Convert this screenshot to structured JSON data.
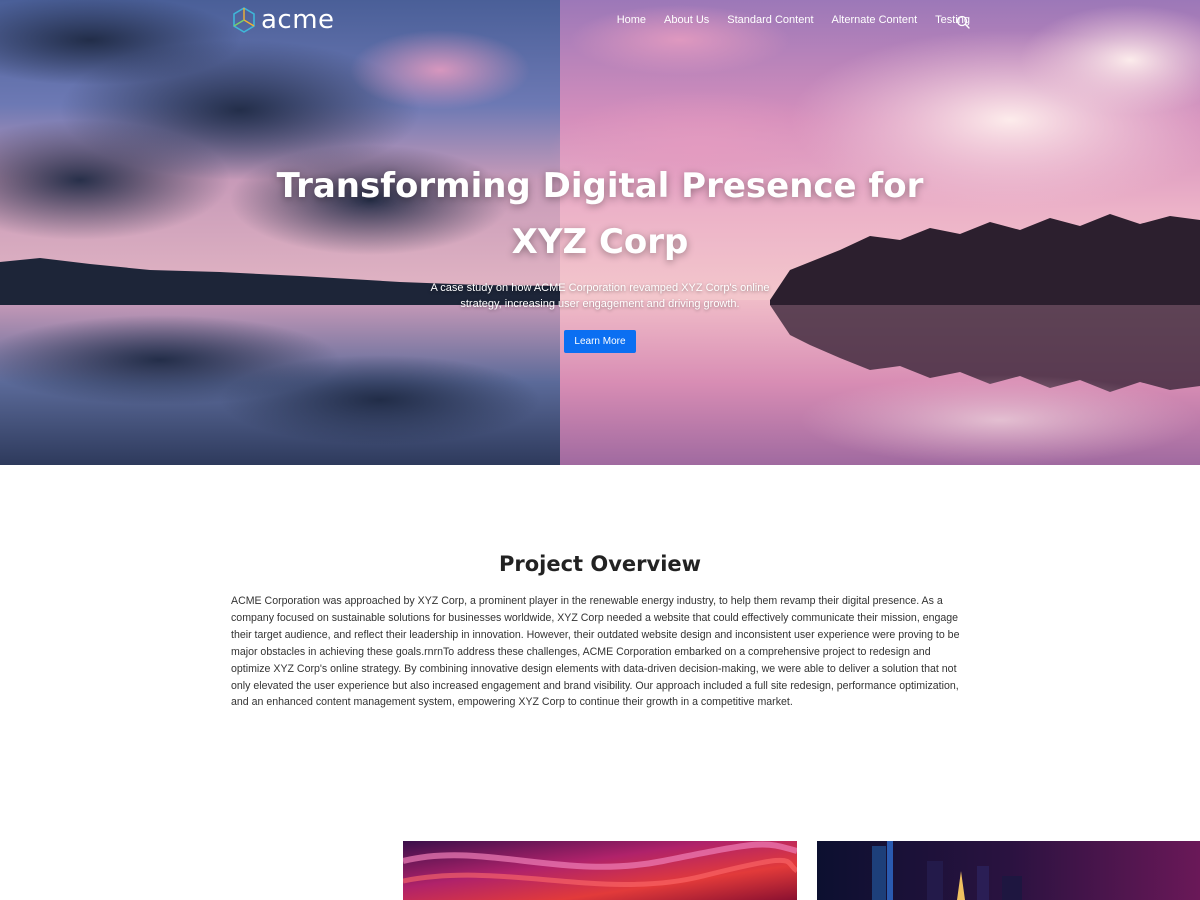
{
  "header": {
    "logo_text": "acme",
    "logo_icon": "hexagon-logo-icon",
    "nav": [
      {
        "label": "Home"
      },
      {
        "label": "About Us"
      },
      {
        "label": "Standard Content"
      },
      {
        "label": "Alternate Content"
      },
      {
        "label": "Testing"
      }
    ],
    "search_icon": "search-icon"
  },
  "hero": {
    "title": "Transforming Digital Presence for XYZ Corp",
    "subtitle": "A case study on how ACME Corporation revamped XYZ Corp's online strategy, increasing user engagement and driving growth.",
    "cta_label": "Learn More",
    "cta_color": "#0b6ff2"
  },
  "overview": {
    "title": "Project Overview",
    "body": "ACME Corporation was approached by XYZ Corp, a prominent player in the renewable energy industry, to help them revamp their digital presence. As a company focused on sustainable solutions for businesses worldwide, XYZ Corp needed a website that could effectively communicate their mission, engage their target audience, and reflect their leadership in innovation. However, their outdated website design and inconsistent user experience were proving to be major obstacles in achieving these goals.rnrnTo address these challenges, ACME Corporation embarked on a comprehensive project to redesign and optimize XYZ Corp's online strategy. By combining innovative design elements with data-driven decision-making, we were able to deliver a solution that not only elevated the user experience but also increased engagement and brand visibility. Our approach included a full site redesign, performance optimization, and an enhanced content management system, empowering XYZ Corp to continue their growth in a competitive market."
  }
}
